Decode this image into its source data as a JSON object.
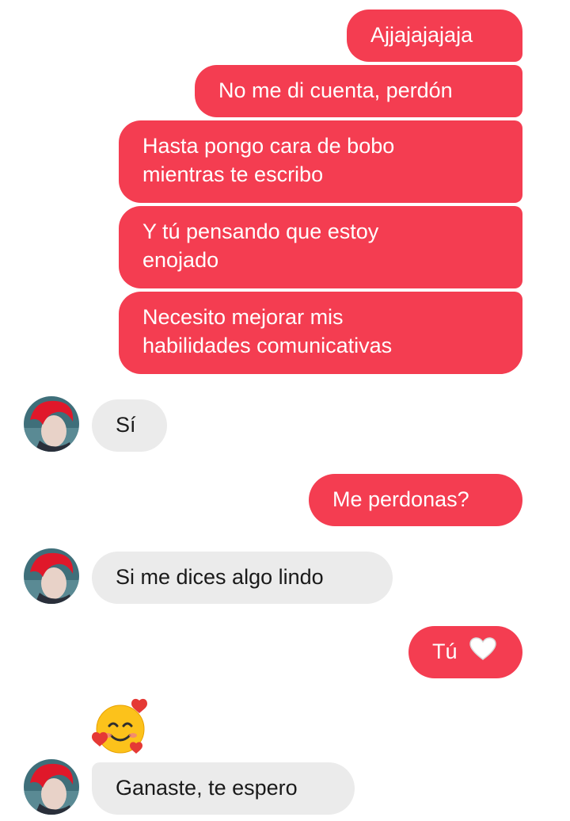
{
  "messages": {
    "sent_1": "Ajjajajajaja",
    "sent_2": "No me di cuenta, perdón",
    "sent_3_line1": "Hasta pongo cara de bobo",
    "sent_3_line2": "mientras te escribo",
    "sent_4_line1": "Y tú pensando que estoy",
    "sent_4_line2": "enojado",
    "sent_5_line1": "Necesito mejorar mis",
    "sent_5_line2": "habilidades comunicativas",
    "received_1": "Sí",
    "sent_6": "Me perdonas?",
    "received_2": "Si me dices algo lindo",
    "sent_7": "Tú",
    "received_3_emoji": "smiling-face-with-hearts",
    "received_4": "Ganaste, te espero"
  },
  "icons": {
    "sent_7_emoji": "white-heart-icon",
    "avatar": "contact-avatar"
  },
  "colors": {
    "sent_bubble": "#f43d51",
    "received_bubble": "#ebebeb",
    "sent_text": "#ffffff",
    "received_text": "#1a1a1a"
  }
}
